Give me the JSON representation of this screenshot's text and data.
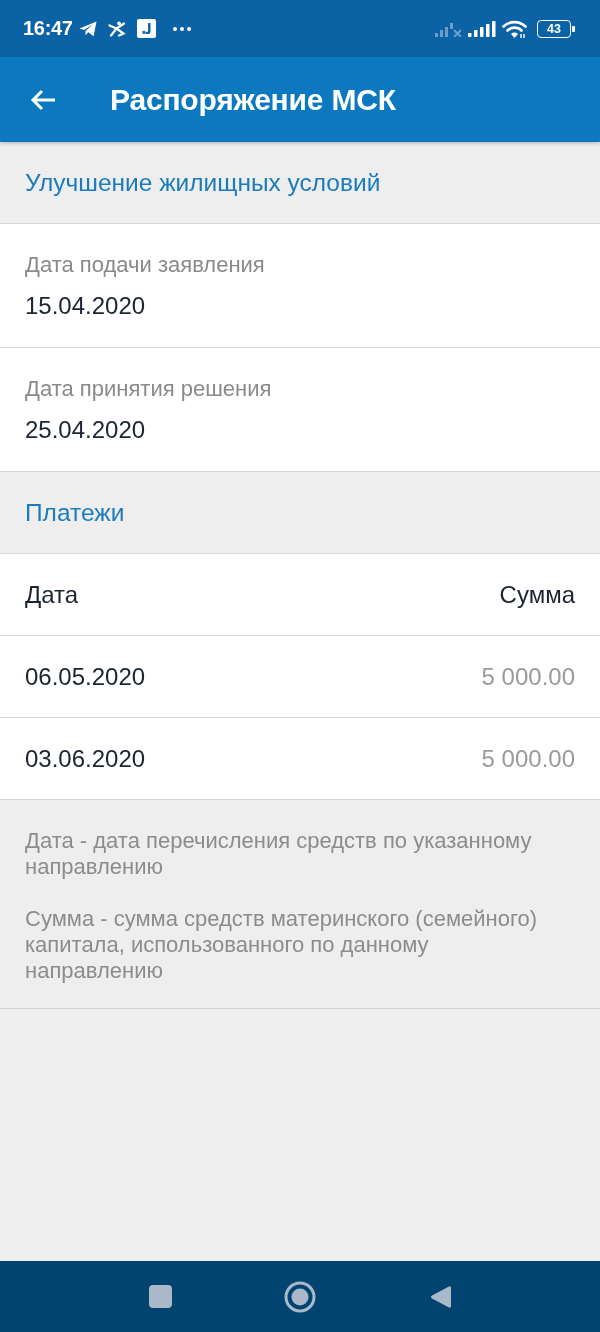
{
  "status_bar": {
    "time": "16:47",
    "battery": "43"
  },
  "app_bar": {
    "title": "Распоряжение МСК"
  },
  "sections": [
    {
      "kind": "fields",
      "title": "Улучшение жилищных условий",
      "fields": [
        {
          "label": "Дата подачи заявления",
          "value": "15.04.2020"
        },
        {
          "label": "Дата принятия решения",
          "value": "25.04.2020"
        }
      ]
    },
    {
      "kind": "table",
      "title": "Платежи",
      "columns": [
        "Дата",
        "Сумма"
      ],
      "rows": [
        [
          "06.05.2020",
          "5 000.00"
        ],
        [
          "03.06.2020",
          "5 000.00"
        ]
      ],
      "notes": [
        "Дата - дата перечисления средств по указанному направлению",
        "Сумма - сумма средств материнского (семейного) капитала, использованного по данному направлению"
      ]
    }
  ]
}
